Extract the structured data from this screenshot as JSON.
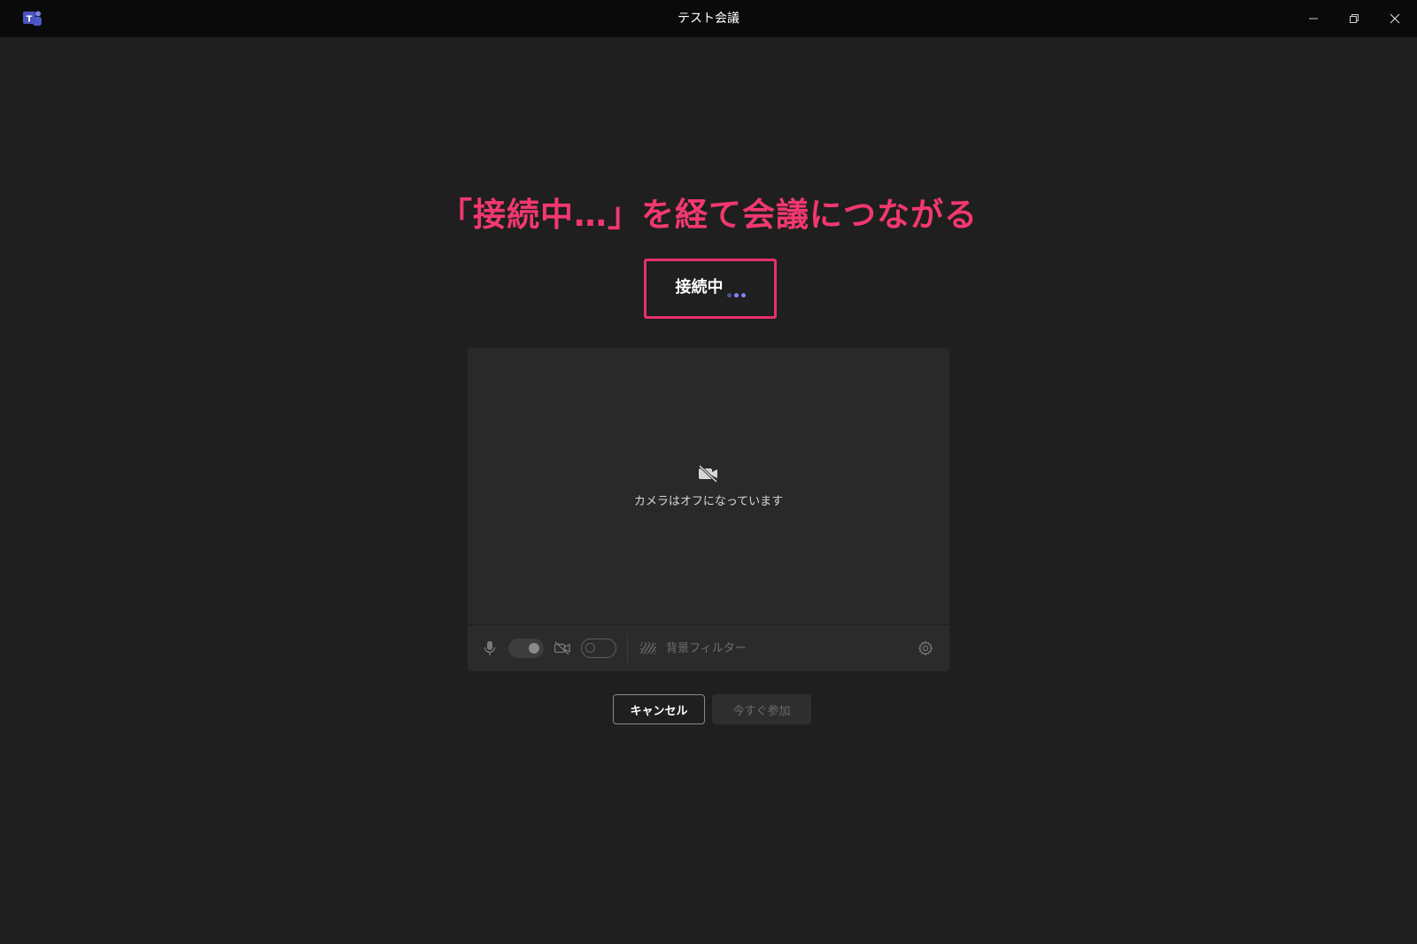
{
  "window": {
    "title": "テスト会議",
    "app_icon": "teams-logo-icon",
    "controls": [
      "minimize-icon",
      "restore-icon",
      "close-icon"
    ]
  },
  "annotation": {
    "text": "「接続中…」を経て会議につながる",
    "color": "#f2386f"
  },
  "status": {
    "label": "接続中",
    "highlight_color": "#e8306a",
    "dot_color": "#7f85f5"
  },
  "preview": {
    "camera_off_icon": "video-off-icon",
    "camera_off_text": "カメラはオフになっています",
    "controls": {
      "mic_icon": "microphone-icon",
      "mic_on": true,
      "camera_icon": "video-off-icon",
      "camera_on": false,
      "background_icon": "background-effects-icon",
      "background_label": "背景フィルター",
      "settings_icon": "gear-icon"
    }
  },
  "actions": {
    "cancel_label": "キャンセル",
    "join_label": "今すぐ参加"
  }
}
